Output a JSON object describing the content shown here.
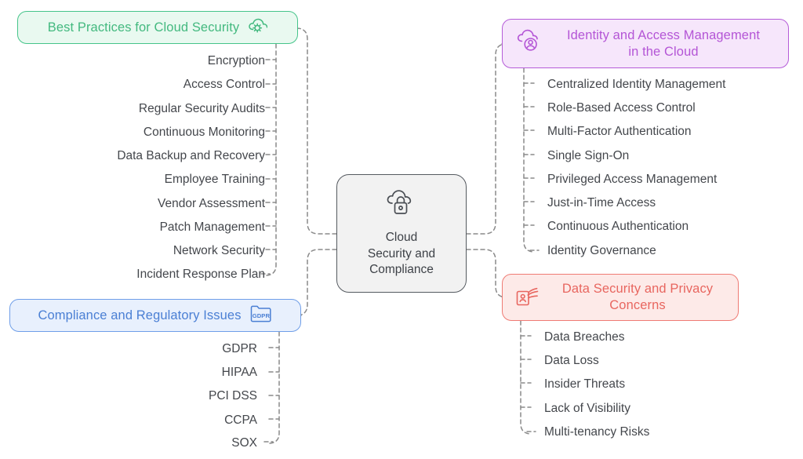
{
  "canvas": {
    "background": "#ffffff",
    "connector_color": "#8a8a8a"
  },
  "central": {
    "title_lines": [
      "Cloud",
      "Security and",
      "Compliance"
    ],
    "icon": "cloud-lock-icon",
    "border_color": "#555a60",
    "fill_color": "#f2f2f2",
    "text_color": "#3d4147"
  },
  "branches": [
    {
      "id": "best-practices",
      "label": "Best Practices for Cloud Security",
      "icon": "cloud-gear-icon",
      "accent": "#3cb878",
      "border_color": "#45c48a",
      "fill_color": "#e9f9f0",
      "text_color": "#43b97f",
      "side": "left",
      "items": [
        "Encryption",
        "Access Control",
        "Regular Security Audits",
        "Continuous Monitoring",
        "Data Backup and Recovery",
        "Employee Training",
        "Vendor Assessment",
        "Patch Management",
        "Network Security",
        "Incident Response Plan"
      ]
    },
    {
      "id": "compliance",
      "label": "Compliance and Regulatory Issues",
      "icon": "gdpr-folder-icon",
      "icon_text": "GDPR",
      "accent": "#4a7fd4",
      "border_color": "#6f9ee8",
      "fill_color": "#e8f0fd",
      "text_color": "#4a7fd4",
      "side": "left",
      "items": [
        "GDPR",
        "HIPAA",
        "PCI DSS",
        "CCPA",
        "SOX"
      ]
    },
    {
      "id": "iam",
      "label_lines": [
        "Identity and Access Management",
        "in the Cloud"
      ],
      "icon": "cloud-user-icon",
      "accent": "#b455d6",
      "border_color": "#b55cd8",
      "fill_color": "#f6e6fb",
      "text_color": "#b455d6",
      "side": "right",
      "items": [
        "Centralized Identity Management",
        "Role-Based Access Control",
        "Multi-Factor Authentication",
        "Single Sign-On",
        "Privileged Access Management",
        "Just-in-Time Access",
        "Continuous Authentication",
        "Identity Governance"
      ]
    },
    {
      "id": "data-security",
      "label_lines": [
        "Data Security and Privacy",
        "Concerns"
      ],
      "icon": "id-badge-hand-icon",
      "accent": "#e8665f",
      "border_color": "#ef7b74",
      "fill_color": "#fdeae8",
      "text_color": "#e8665f",
      "side": "right",
      "items": [
        "Data Breaches",
        "Data Loss",
        "Insider Threats",
        "Lack of Visibility",
        "Multi-tenancy Risks"
      ]
    }
  ]
}
